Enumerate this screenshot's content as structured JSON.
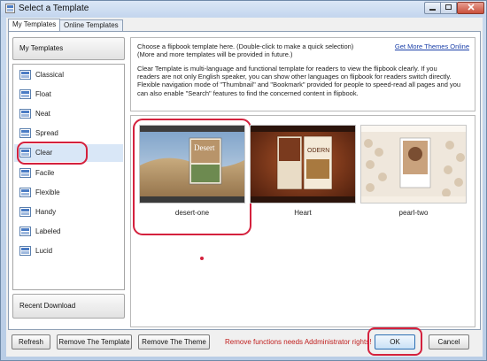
{
  "window": {
    "title": "Select a Template"
  },
  "tabs": [
    {
      "label": "My Templates",
      "active": true
    },
    {
      "label": "Online Templates",
      "active": false
    }
  ],
  "sidebar": {
    "header": "My Templates",
    "items": [
      {
        "label": "Classical",
        "icon": "template-icon"
      },
      {
        "label": "Float",
        "icon": "template-icon"
      },
      {
        "label": "Neat",
        "icon": "template-icon"
      },
      {
        "label": "Spread",
        "icon": "template-icon"
      },
      {
        "label": "Clear",
        "icon": "template-icon",
        "selected": true
      },
      {
        "label": "Facile",
        "icon": "template-icon"
      },
      {
        "label": "Flexible",
        "icon": "template-icon"
      },
      {
        "label": "Handy",
        "icon": "template-icon"
      },
      {
        "label": "Labeled",
        "icon": "template-icon"
      },
      {
        "label": "Lucid",
        "icon": "template-icon"
      }
    ],
    "footer": "Recent Download"
  },
  "info": {
    "hint_line1": "Choose a flipbook template here. (Double-click to make a quick selection)",
    "hint_line2": "(More and more templates will be provided in future.)",
    "more_link": "Get More Themes Online",
    "desc_line1": "Clear Template is multi-language and functional template for readers to view the flipbook clearly. If you",
    "desc_line2": "readers are not only English speaker, you can show other languages on flipbook for readers switch directly.",
    "desc_line3": "Flexible navigation mode of \"Thumbnail\" and \"Bookmark\" provided for people to speed-read all pages and you",
    "desc_line4": "can also enable \"Search\" features to find the concerned content in flipbook."
  },
  "themes": [
    {
      "name": "desert-one",
      "cover_text": "Desert",
      "selected": true
    },
    {
      "name": "Heart",
      "cover_text": "ODERN"
    },
    {
      "name": "pearl-two"
    }
  ],
  "buttons": {
    "refresh": "Refresh",
    "remove_template": "Remove The Template",
    "remove_theme": "Remove The Theme",
    "ok": "OK",
    "cancel": "Cancel"
  },
  "notice": "Remove functions needs Addministrator rights!",
  "colors": {
    "highlight_ring": "#d4213d",
    "link": "#1a3fa8",
    "notice": "#c0201f"
  }
}
